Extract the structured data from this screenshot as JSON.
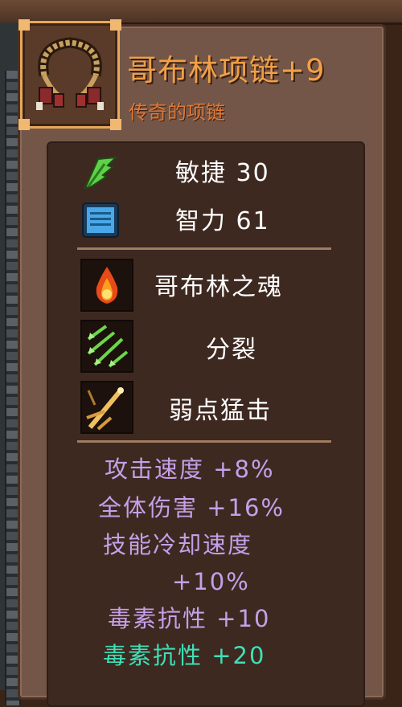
{
  "item": {
    "name": "哥布林项链+9",
    "quality": "传奇的项链",
    "icon": "goblin-necklace-icon"
  },
  "base_stats": [
    {
      "label": "敏捷 30",
      "icon": "agility-feather-icon",
      "color": "#5fd04a"
    },
    {
      "label": "智力 61",
      "icon": "intelligence-book-icon",
      "color": "#4aa8e8"
    }
  ],
  "skills": [
    {
      "label": "哥布林之魂",
      "icon": "goblin-soul-fire-icon"
    },
    {
      "label": "分裂",
      "icon": "split-arrows-icon"
    },
    {
      "label": "弱点猛击",
      "icon": "weak-point-strike-icon"
    }
  ],
  "bonuses": [
    {
      "label": "攻击速度 +8%",
      "color": "#c5a0e8"
    },
    {
      "label": "全体伤害 +16%",
      "color": "#c5a0e8"
    },
    {
      "label": "技能冷却速度",
      "color": "#c5a0e8"
    },
    {
      "label": "+10%",
      "color": "#c5a0e8"
    },
    {
      "label": "毒素抗性 +10",
      "color": "#c5a0e8"
    },
    {
      "label": "毒素抗性 +20",
      "color": "#3ee0b8"
    }
  ]
}
